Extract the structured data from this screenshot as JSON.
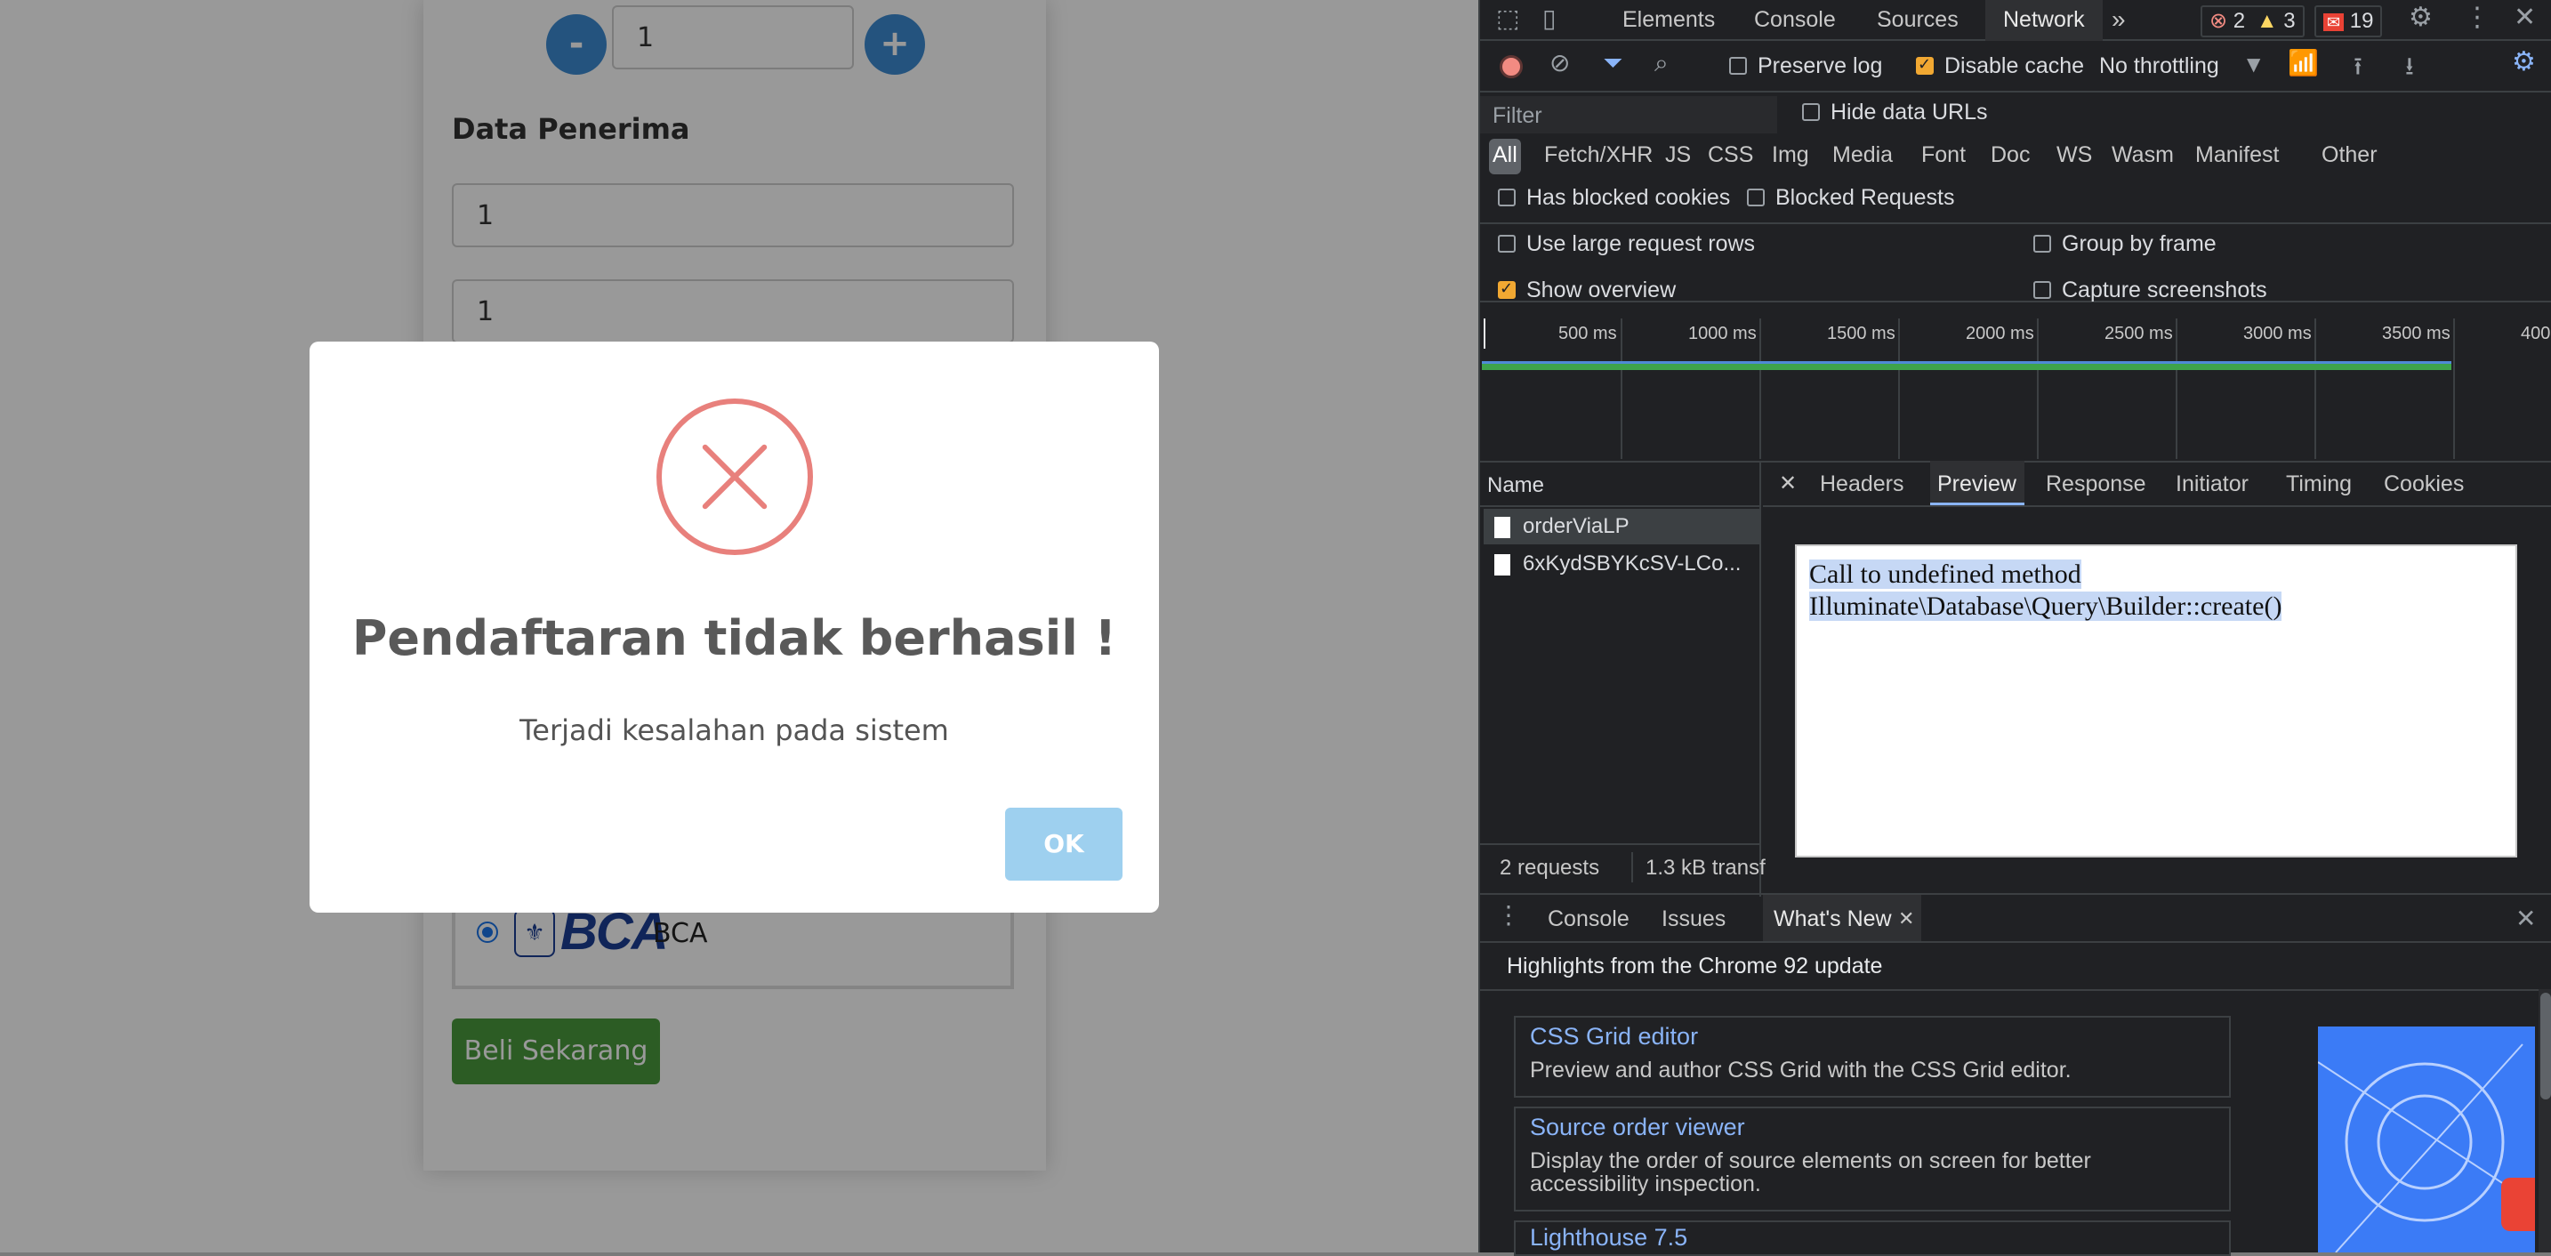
{
  "web": {
    "quantity": {
      "minus": "-",
      "value": "1",
      "plus": "+"
    },
    "section_title": "Data Penerima",
    "field1_value": "1",
    "field2_value": "1",
    "bank": {
      "seal": "⚜",
      "logo": "BCA",
      "name": "BCA"
    },
    "buy_button": "Beli Sekarang",
    "modal": {
      "title": "Pendaftaran tidak berhasil !",
      "message": "Terjadi kesalahan pada sistem",
      "ok_button": "OK"
    }
  },
  "devtools": {
    "tabs": [
      "Elements",
      "Console",
      "Sources",
      "Network"
    ],
    "active_tab": "Network",
    "more_tabs": "»",
    "counts": {
      "errors": "2",
      "warnings": "3",
      "issues": "19"
    },
    "toolbar": {
      "preserve_log": "Preserve log",
      "disable_cache": "Disable cache",
      "throttling": "No throttling"
    },
    "filter": {
      "placeholder": "Filter",
      "hide_data_urls": "Hide data URLs",
      "types": [
        "All",
        "Fetch/XHR",
        "JS",
        "CSS",
        "Img",
        "Media",
        "Font",
        "Doc",
        "WS",
        "Wasm",
        "Manifest",
        "Other"
      ],
      "has_blocked_cookies": "Has blocked cookies",
      "blocked_requests": "Blocked Requests"
    },
    "settings": {
      "large_rows": "Use large request rows",
      "group_by_frame": "Group by frame",
      "show_overview": "Show overview",
      "capture_screenshots": "Capture screenshots"
    },
    "timeline_ticks": [
      "500 ms",
      "1000 ms",
      "1500 ms",
      "2000 ms",
      "2500 ms",
      "3000 ms",
      "3500 ms",
      "400"
    ],
    "requests_header": "Name",
    "requests": [
      "orderViaLP",
      "6xKydSBYKcSV-LCo..."
    ],
    "status": {
      "requests": "2 requests",
      "transferred": "1.3 kB transf"
    },
    "preview_tabs": [
      "Headers",
      "Preview",
      "Response",
      "Initiator",
      "Timing",
      "Cookies"
    ],
    "active_preview_tab": "Preview",
    "preview_text": {
      "line1": "Call to undefined method",
      "line2": "Illuminate\\Database\\Query\\Builder::create()"
    },
    "drawer_tabs": [
      "Console",
      "Issues",
      "What's New"
    ],
    "whats_new": {
      "heading": "Highlights from the Chrome 92 update",
      "items": [
        {
          "title": "CSS Grid editor",
          "desc": "Preview and author CSS Grid with the CSS Grid editor."
        },
        {
          "title": "Source order viewer",
          "desc": "Display the order of source elements on screen for better accessibility inspection."
        },
        {
          "title": "Lighthouse 7.5",
          "desc": ""
        }
      ]
    },
    "colors": {
      "accent": "#8ab4f8",
      "timeline_bar": "#3ea34b",
      "error": "#f28b82",
      "warning": "#fdd663"
    }
  }
}
